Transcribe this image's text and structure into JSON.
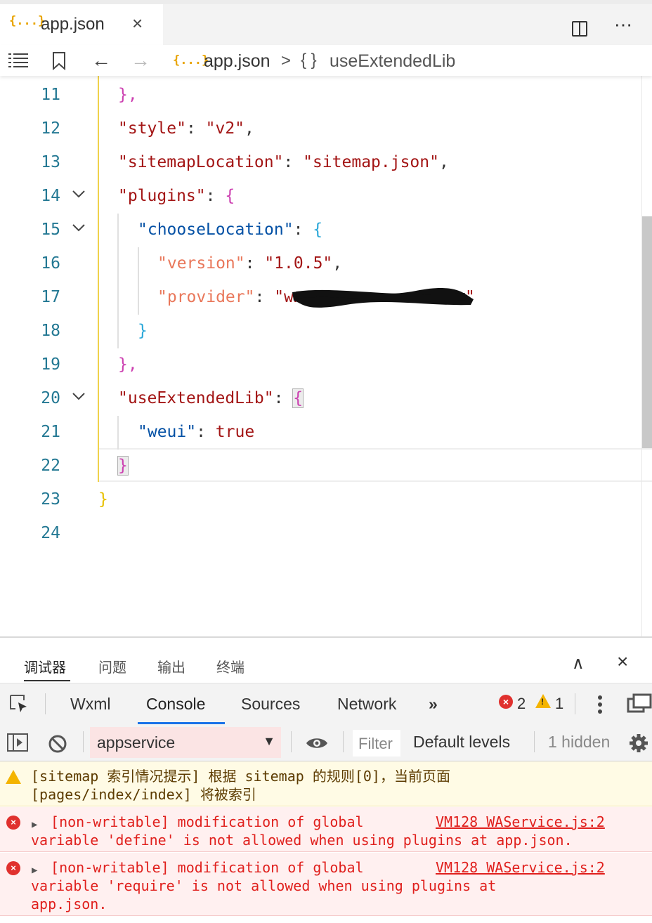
{
  "tab": {
    "icon": "{...}",
    "label": "app.json",
    "close": "×"
  },
  "breadcrumb": {
    "file_icon": "{...}",
    "file": "app.json",
    "sep": ">",
    "obj_icon": "{ }",
    "symbol": "useExtendedLib"
  },
  "toolbar": {
    "more": "⋯"
  },
  "editor": {
    "line_numbers": [
      "11",
      "12",
      "13",
      "14",
      "15",
      "16",
      "17",
      "18",
      "19",
      "20",
      "21",
      "22",
      "23",
      "24"
    ],
    "lines": {
      "l11": "},",
      "l12_key": "\"style\"",
      "l12_val": "\"v2\"",
      "l13_key": "\"sitemapLocation\"",
      "l13_val": "\"sitemap.json\"",
      "l14_key": "\"plugins\"",
      "l14_brace": "{",
      "l15_key": "\"chooseLocation\"",
      "l15_brace": "{",
      "l16_key": "\"version\"",
      "l16_val": "\"1.0.5\"",
      "l17_key": "\"provider\"",
      "l17_val_start": "\"wx",
      "l17_val_end": "\"",
      "l18": "}",
      "l19": "},",
      "l20_key": "\"useExtendedLib\"",
      "l20_brace": "{",
      "l21_key": "\"weui\"",
      "l21_val": "true",
      "l22": "}",
      "l23": "}"
    }
  },
  "panel": {
    "tabs": [
      "调试器",
      "问题",
      "输出",
      "终端"
    ],
    "up": "∧",
    "close": "×",
    "devtools_tabs": [
      "Wxml",
      "Console",
      "Sources",
      "Network"
    ],
    "overflow": "»",
    "error_count": "2",
    "warning_count": "1",
    "context": "appservice",
    "filter_placeholder": "Filter",
    "levels": "Default levels",
    "hidden": "1 hidden"
  },
  "console": {
    "warning": {
      "line1": "[sitemap 索引情况提示] 根据 sitemap 的规则[0]，当前页面",
      "line2": "[pages/index/index] 将被索引"
    },
    "errors": [
      {
        "line1": " [non-writable] modification of global",
        "line2": "variable 'define' is not allowed when using plugins at app.json.",
        "source": "VM128 WAService.js:2"
      },
      {
        "line1": " [non-writable] modification of global",
        "line2": "variable 'require' is not allowed when using plugins at",
        "line3": "app.json.",
        "source": "VM128 WAService.js:2"
      }
    ]
  }
}
